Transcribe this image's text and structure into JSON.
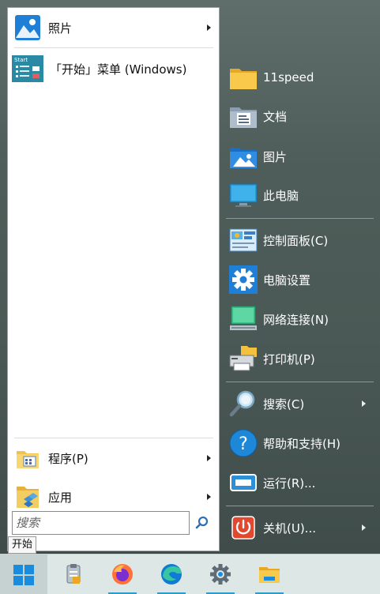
{
  "left_pane": {
    "items": [
      {
        "label": "照片",
        "icon": "photos-icon",
        "has_submenu": true
      },
      {
        "label": "「开始」菜单 (Windows)",
        "icon": "start-menu-app-icon",
        "has_submenu": false
      },
      {
        "label": "程序(P)",
        "icon": "programs-folder-icon",
        "has_submenu": true
      },
      {
        "label": "应用",
        "icon": "apps-folder-icon",
        "has_submenu": true
      }
    ],
    "start_tile_caption": "Start"
  },
  "search": {
    "placeholder": "搜索"
  },
  "right_pane": {
    "items": [
      {
        "label": "11speed",
        "icon": "user-folder-icon"
      },
      {
        "label": "文档",
        "icon": "documents-icon"
      },
      {
        "label": "图片",
        "icon": "pictures-icon"
      },
      {
        "label": "此电脑",
        "icon": "this-pc-icon"
      },
      {
        "label": "控制面板(C)",
        "icon": "control-panel-icon"
      },
      {
        "label": "电脑设置",
        "icon": "settings-gear-icon"
      },
      {
        "label": "网络连接(N)",
        "icon": "network-icon"
      },
      {
        "label": "打印机(P)",
        "icon": "printer-icon"
      },
      {
        "label": "搜索(C)",
        "icon": "search-magnifier-icon",
        "has_submenu": true
      },
      {
        "label": "帮助和支持(H)",
        "icon": "help-icon"
      },
      {
        "label": "运行(R)...",
        "icon": "run-icon"
      },
      {
        "label": "关机(U)...",
        "icon": "power-icon",
        "has_submenu": true
      }
    ]
  },
  "tooltip": "开始",
  "taskbar": {
    "buttons": [
      "windows-start-icon",
      "clipboard-icon",
      "firefox-icon",
      "edge-icon",
      "settings-icon",
      "file-explorer-icon"
    ]
  },
  "colors": {
    "accent": "#2e9ac7",
    "right_pane_bg": "#4f5d5a",
    "taskbar_bg": "#dde7e6"
  }
}
